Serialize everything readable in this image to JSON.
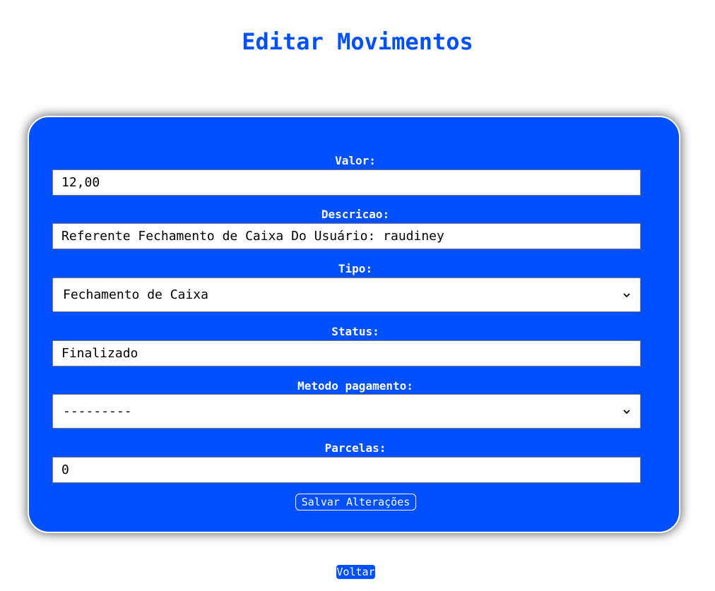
{
  "page": {
    "title": "Editar Movimentos"
  },
  "form": {
    "valor": {
      "label": "Valor:",
      "value": "12,00"
    },
    "descricao": {
      "label": "Descricao:",
      "value": "Referente Fechamento de Caixa Do Usuário: raudiney"
    },
    "tipo": {
      "label": "Tipo:",
      "selected": "Fechamento de Caixa"
    },
    "status": {
      "label": "Status:",
      "value": "Finalizado"
    },
    "metodo_pagamento": {
      "label": "Metodo pagamento:",
      "selected": "---------"
    },
    "parcelas": {
      "label": "Parcelas:",
      "value": "0"
    },
    "save_label": "Salvar Alterações"
  },
  "nav": {
    "back_label": "Voltar"
  },
  "colors": {
    "accent": "#0050ff",
    "background": "#ffffff"
  }
}
